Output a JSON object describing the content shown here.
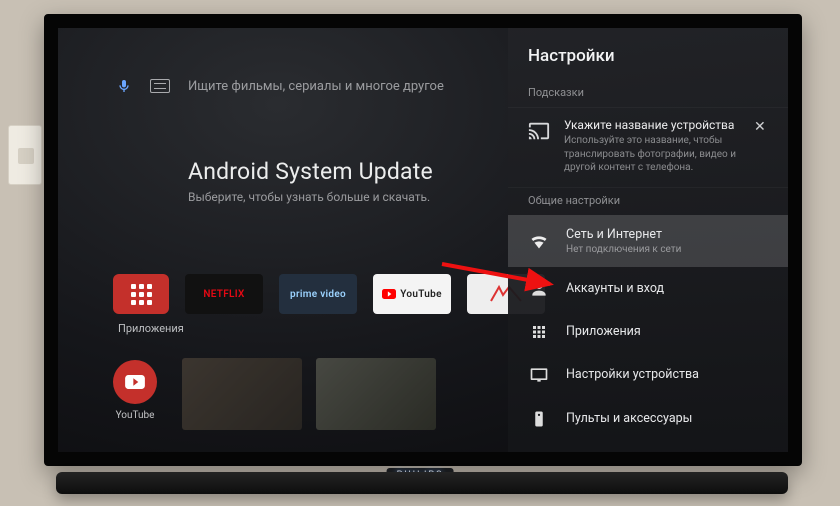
{
  "brand": "PHILIPS",
  "search": {
    "placeholder": "Ищите фильмы, сериалы и многое другое"
  },
  "hero": {
    "title": "Android System Update",
    "subtitle": "Выберите, чтобы узнать больше и скачать."
  },
  "apps": {
    "label": "Приложения",
    "tiles": [
      {
        "name": "apps-hub",
        "label": ""
      },
      {
        "name": "netflix",
        "label": "NETFLIX"
      },
      {
        "name": "prime-video",
        "label": "prime video"
      },
      {
        "name": "youtube",
        "label": "YouTube"
      },
      {
        "name": "store",
        "label": ""
      }
    ]
  },
  "youtube_hub": {
    "label": "YouTube"
  },
  "settings": {
    "title": "Настройки",
    "hints_label": "Подсказки",
    "hint": {
      "title": "Укажите название устройства",
      "subtitle": "Используйте это название, чтобы транслировать фотографии, видео и другой контент с телефона."
    },
    "general_label": "Общие настройки",
    "items": [
      {
        "id": "network",
        "title": "Сеть и Интернет",
        "subtitle": "Нет подключения к сети",
        "selected": true
      },
      {
        "id": "accounts",
        "title": "Аккаунты и вход",
        "subtitle": ""
      },
      {
        "id": "apps",
        "title": "Приложения",
        "subtitle": ""
      },
      {
        "id": "device",
        "title": "Настройки устройства",
        "subtitle": ""
      },
      {
        "id": "remotes",
        "title": "Пульты и аксессуары",
        "subtitle": ""
      }
    ]
  }
}
